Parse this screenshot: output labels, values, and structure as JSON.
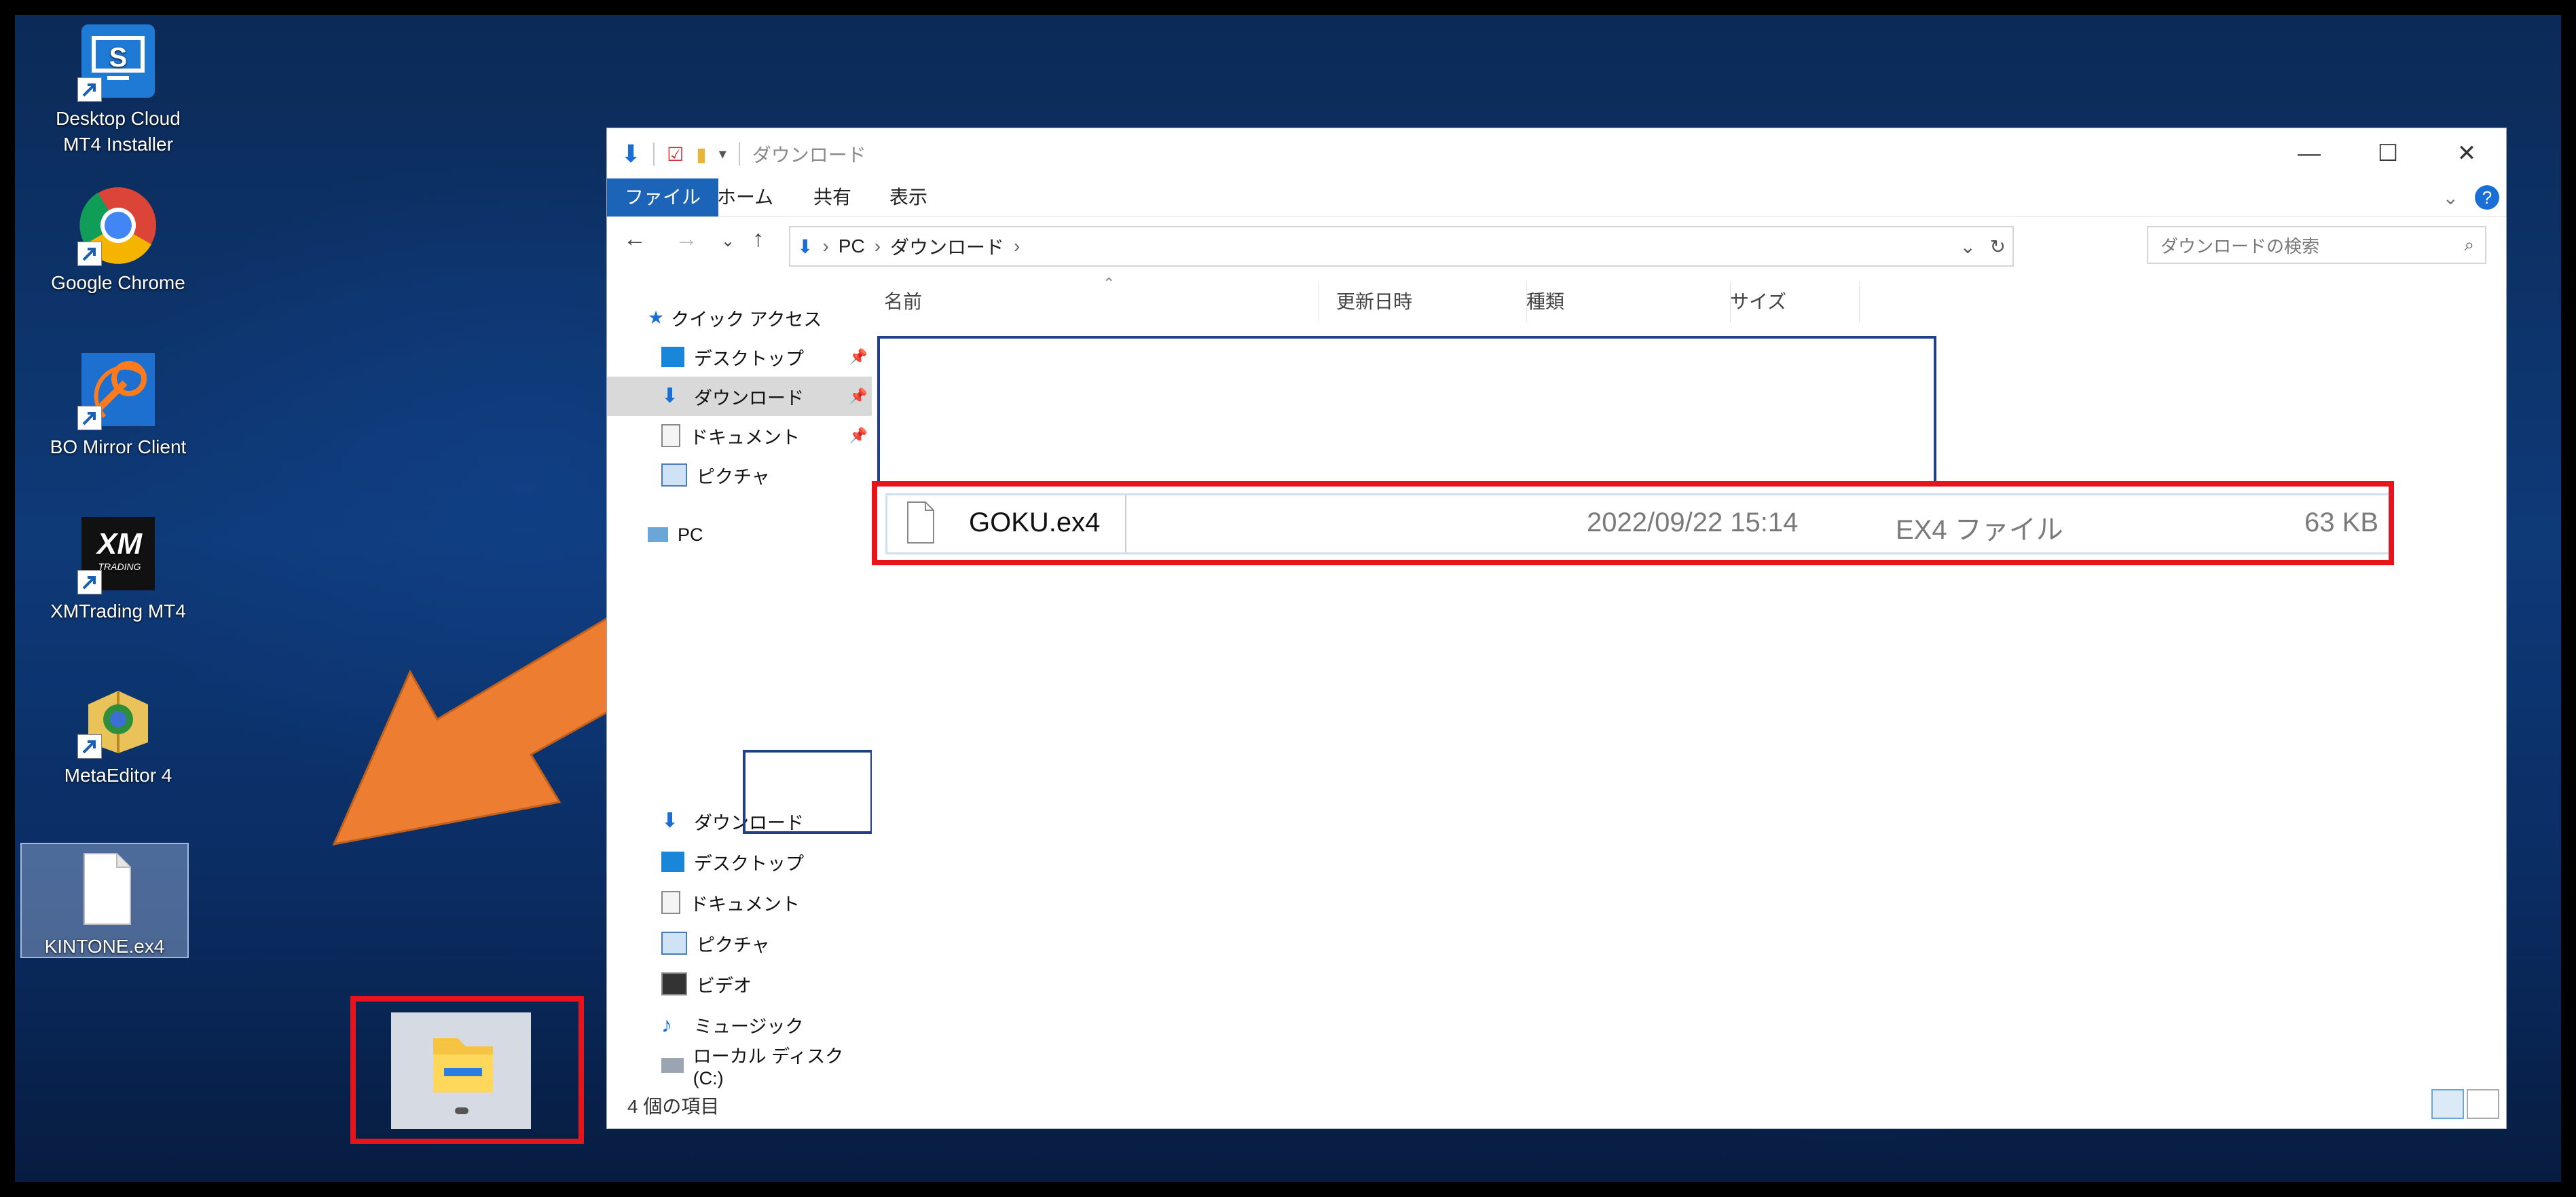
{
  "desktop": {
    "icons": [
      {
        "label_1": "Desktop Cloud",
        "label_2": "MT4 Installer",
        "icon": "cloud-monitor-icon"
      },
      {
        "label_1": "Google Chrome",
        "icon": "chrome-icon"
      },
      {
        "label_1": "BO Mirror Client",
        "icon": "satellite-icon"
      },
      {
        "label_1": "XMTrading MT4",
        "icon": "xm-logo-icon"
      },
      {
        "label_1": "MetaEditor 4",
        "icon": "metaeditor-book-icon"
      },
      {
        "label_1": "KINTONE.ex4",
        "icon": "file-icon"
      }
    ]
  },
  "explorer": {
    "title": "ダウンロード",
    "ribbon_tabs": [
      "ファイル",
      "ホーム",
      "共有",
      "表示"
    ],
    "address": {
      "pc": "PC",
      "folder": "ダウンロード"
    },
    "search_placeholder": "ダウンロードの検索",
    "nav": {
      "quick_access": "クイック アクセス",
      "quick_items": [
        "デスクトップ",
        "ダウンロード",
        "ドキュメント",
        "ピクチャ"
      ],
      "pc": "PC",
      "pc_items": [
        "ダウンロード",
        "デスクトップ",
        "ドキュメント",
        "ピクチャ",
        "ビデオ",
        "ミュージック",
        "ローカル ディスク (C:)"
      ]
    },
    "columns": [
      "名前",
      "更新日時",
      "種類",
      "サイズ"
    ],
    "file": {
      "name": "GOKU.ex4",
      "date": "2022/09/22 15:14",
      "type": "EX4 ファイル",
      "size": "63 KB"
    },
    "status": "4 個の項目"
  },
  "colors": {
    "highlight_red": "#e8141c",
    "arrow_orange": "#ed7d31",
    "ribbon_blue": "#1c64b8"
  }
}
